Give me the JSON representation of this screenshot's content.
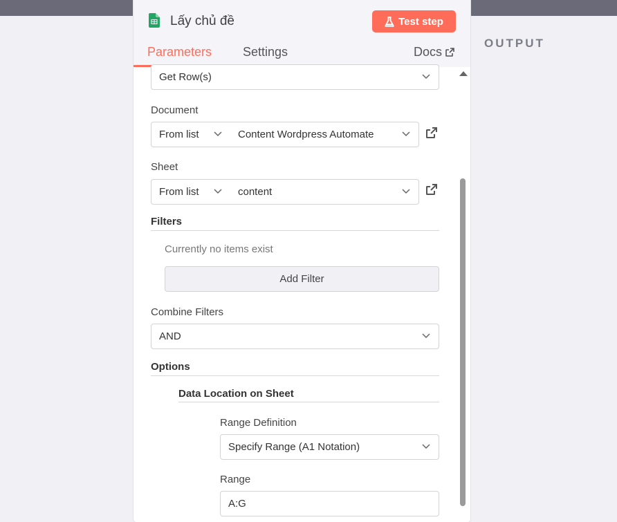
{
  "output": {
    "title": "OUTPUT"
  },
  "node": {
    "title": "Lấy chủ đề",
    "icon": "google-sheets-icon",
    "brand_color": "#23a566"
  },
  "header": {
    "test_step_label": "Test step",
    "tabs": [
      {
        "label": "Parameters",
        "active": true
      },
      {
        "label": "Settings",
        "active": false
      }
    ],
    "docs_label": "Docs",
    "accent_color": "#ff6d5a"
  },
  "fields": {
    "operation": {
      "value": "Get Row(s)"
    },
    "document": {
      "label": "Document",
      "mode": "From list",
      "value": "Content Wordpress Automate"
    },
    "sheet": {
      "label": "Sheet",
      "mode": "From list",
      "value": "content"
    },
    "filters": {
      "title": "Filters",
      "empty_text": "Currently no items exist",
      "add_label": "Add Filter"
    },
    "combine_filters": {
      "label": "Combine Filters",
      "value": "AND"
    },
    "options": {
      "title": "Options",
      "data_location": {
        "title": "Data Location on Sheet",
        "range_definition": {
          "label": "Range Definition",
          "value": "Specify Range (A1 Notation)"
        },
        "range": {
          "label": "Range",
          "value": "A:G"
        }
      }
    }
  }
}
